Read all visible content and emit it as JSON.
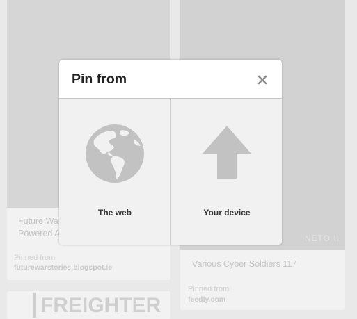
{
  "modal": {
    "title": "Pin from",
    "close_icon": "close-icon",
    "options": [
      {
        "label": "The web",
        "icon": "globe-icon"
      },
      {
        "label": "Your device",
        "icon": "upload-arrow-icon"
      }
    ]
  },
  "background_pins": [
    {
      "title": "Future War... Powered A...",
      "title_lines": [
        "Future War",
        "Powered A"
      ],
      "pinned_label": "Pinned from",
      "source": "futurewarstories.blogspot.ie"
    },
    {
      "title": "Various Cyber Soldiers 117",
      "pinned_label": "Pinned from",
      "source": "feedly.com",
      "watermark": "NETO II"
    },
    {
      "title": "FREIGHTER"
    }
  ],
  "colors": {
    "overlay_background": "#e9e9e9",
    "modal_background": "#ffffff",
    "options_background": "#f1f1f1",
    "icon_gray": "#c2c2c2",
    "title_text": "#222222"
  }
}
